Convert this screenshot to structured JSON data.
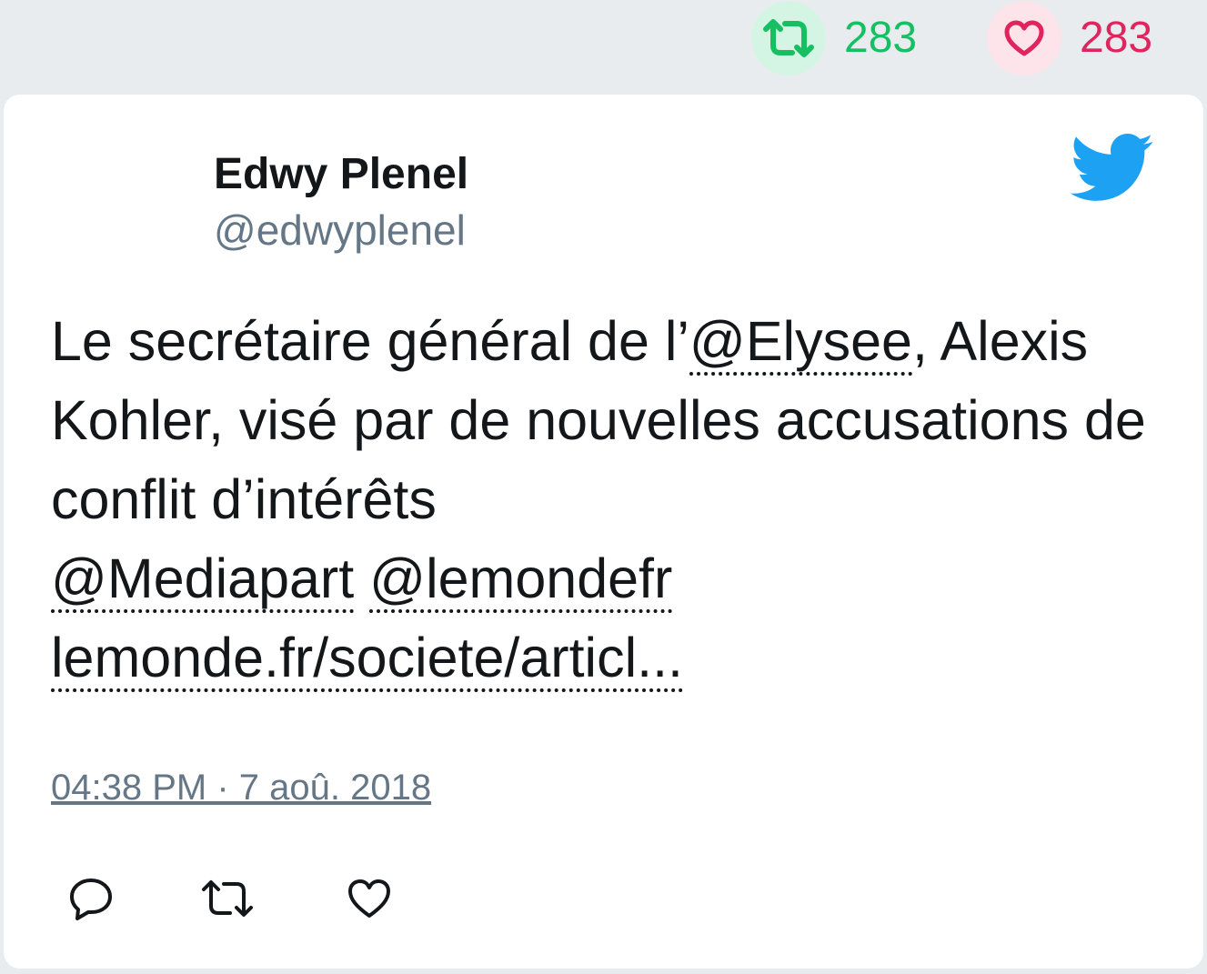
{
  "stats": {
    "retweet_count": "283",
    "like_count": "283",
    "retweet_icon": "retweet-icon",
    "like_icon": "heart-icon"
  },
  "tweet": {
    "author_name": "Edwy Plenel",
    "author_handle": "@edwyplenel",
    "text_part1": "Le secrétaire général de l’",
    "mention_elysee": "@Elysee",
    "text_part2": ", Alexis Kohler, visé par de nouvelles accusations de conflit d’intérêts ",
    "mention_mediapart": "@Mediapart",
    "text_space": " ",
    "mention_lemondefr": "@lemondefr",
    "link_text": "lemonde.fr/societe/articl...",
    "timestamp": "04:38 PM · 7 aoû. 2018"
  },
  "actions": {
    "reply_icon": "reply-icon",
    "retweet_icon": "retweet-icon",
    "like_icon": "heart-icon"
  },
  "colors": {
    "retweet_green": "#17bf63",
    "like_red": "#e0245e",
    "twitter_blue": "#1da1f2",
    "handle_gray": "#657786"
  }
}
